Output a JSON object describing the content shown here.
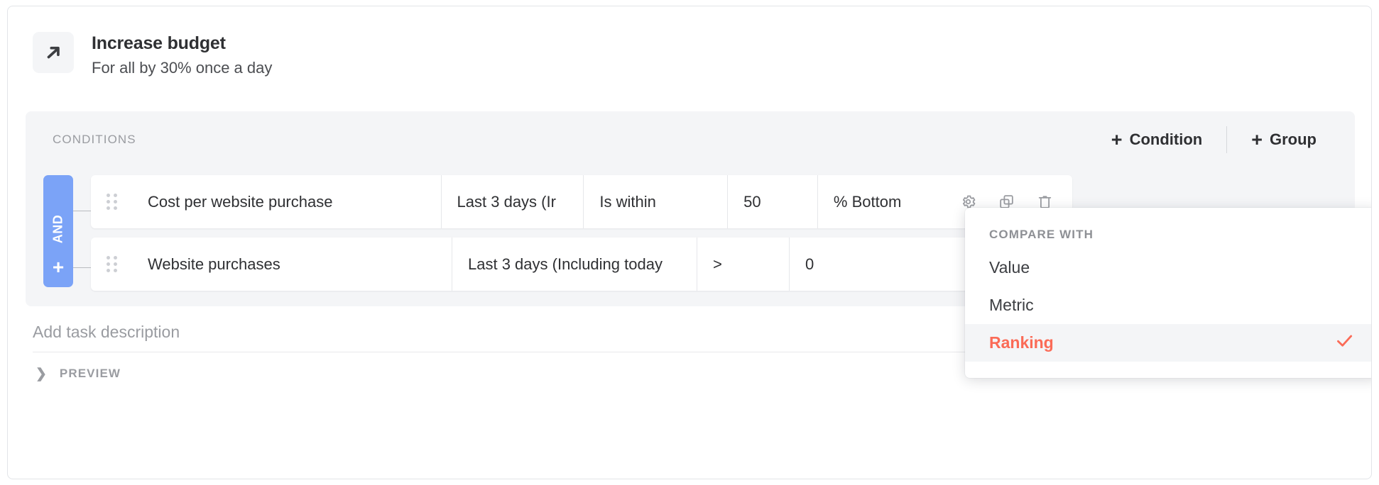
{
  "task": {
    "icon": "trending-up-arrow-icon",
    "title": "Increase budget",
    "subtitle": "For all by 30% once a day"
  },
  "conditions": {
    "label": "CONDITIONS",
    "add_condition_label": "Condition",
    "add_group_label": "Group",
    "plus_glyph": "+",
    "logic_operator": "AND",
    "add_row_glyph": "+",
    "rows": [
      {
        "metric": "Cost per website purchase",
        "date_range": "Last 3 days (Ir",
        "operator": "Is within",
        "value": "50",
        "ranking": "% Bottom",
        "actions": [
          "gear-icon",
          "duplicate-icon",
          "trash-icon"
        ]
      },
      {
        "metric": "Website purchases",
        "date_range": "Last 3 days (Including today",
        "operator": ">",
        "value": "0"
      }
    ]
  },
  "description": {
    "placeholder": "Add task description",
    "value": ""
  },
  "preview": {
    "label": "PREVIEW",
    "chevron": "❯"
  },
  "dropdown": {
    "header": "COMPARE WITH",
    "items": [
      {
        "label": "Value",
        "selected": false
      },
      {
        "label": "Metric",
        "selected": false
      },
      {
        "label": "Ranking",
        "selected": true
      }
    ]
  },
  "colors": {
    "logic_blue": "#7ba3f7",
    "accent_red": "#fb6b57",
    "panel_bg": "#f4f5f7",
    "muted_text": "#9a9ca1"
  }
}
